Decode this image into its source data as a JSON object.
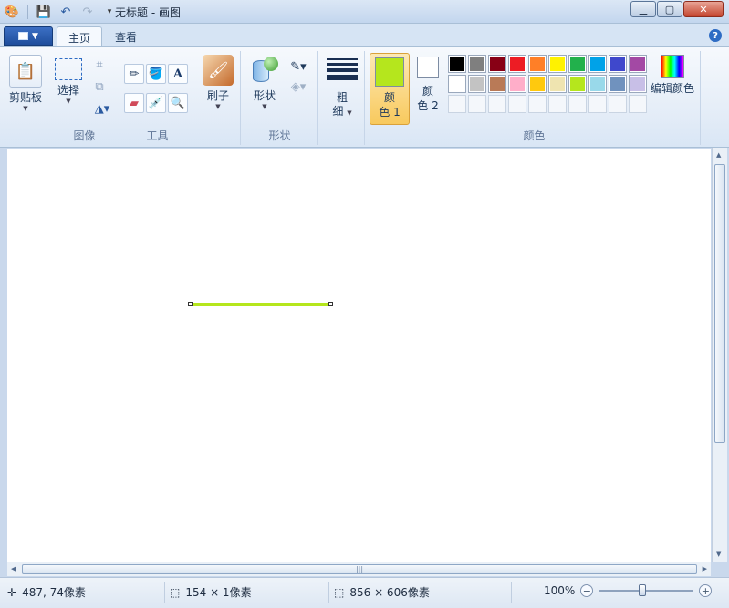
{
  "window": {
    "title": "无标题 - 画图"
  },
  "tabs": [
    {
      "label": "主页"
    },
    {
      "label": "查看"
    }
  ],
  "clipboard": {
    "paste_label": "剪贴板"
  },
  "image": {
    "select_label": "选择",
    "group_label": "图像"
  },
  "tools": {
    "group_label": "工具"
  },
  "brush": {
    "label": "刷子"
  },
  "shapes": {
    "label": "形状",
    "group_label": "形状"
  },
  "size": {
    "label_line1": "粗",
    "label_line2": "细"
  },
  "colors": {
    "color1_line1": "颜",
    "color1_line2": "色 1",
    "color2_line1": "颜",
    "color2_line2": "色 2",
    "color1_value": "#b5e61d",
    "color2_value": "#ffffff",
    "edit_label": "编辑颜色",
    "group_label": "颜色",
    "palette_row1": [
      "#000000",
      "#7f7f7f",
      "#880015",
      "#ed1c24",
      "#ff7f27",
      "#fff200",
      "#22b14c",
      "#00a2e8",
      "#3f48cc",
      "#a349a4"
    ],
    "palette_row2": [
      "#ffffff",
      "#c3c3c3",
      "#b97a57",
      "#ffaec9",
      "#ffc90e",
      "#efe4b0",
      "#b5e61d",
      "#99d9ea",
      "#7092be",
      "#c8bfe7"
    ]
  },
  "canvas": {
    "stroke_color": "#b5e61d"
  },
  "status": {
    "cursor_pos": "487, 74像素",
    "selection_size": "154 × 1像素",
    "image_size": "856 × 606像素",
    "zoom": "100%"
  }
}
